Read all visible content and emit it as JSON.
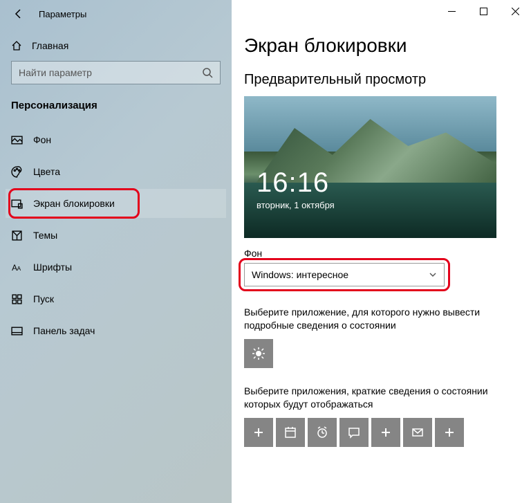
{
  "window": {
    "title": "Параметры"
  },
  "sidebar": {
    "home": "Главная",
    "search_placeholder": "Найти параметр",
    "section": "Персонализация",
    "items": [
      {
        "label": "Фон",
        "icon": "background-icon"
      },
      {
        "label": "Цвета",
        "icon": "colors-icon"
      },
      {
        "label": "Экран блокировки",
        "icon": "lock-screen-icon",
        "active": true
      },
      {
        "label": "Темы",
        "icon": "themes-icon"
      },
      {
        "label": "Шрифты",
        "icon": "fonts-icon"
      },
      {
        "label": "Пуск",
        "icon": "start-icon"
      },
      {
        "label": "Панель задач",
        "icon": "taskbar-icon"
      }
    ]
  },
  "main": {
    "title": "Экран блокировки",
    "preview_heading": "Предварительный просмотр",
    "clock_time": "16:16",
    "clock_date": "вторник, 1 октября",
    "background_label": "Фон",
    "background_value": "Windows: интересное",
    "detailed_app_text": "Выберите приложение, для которого нужно вывести подробные сведения о состоянии",
    "quick_app_text": "Выберите приложения, краткие сведения о состоянии которых будут отображаться"
  },
  "highlight_color": "#e3001b"
}
